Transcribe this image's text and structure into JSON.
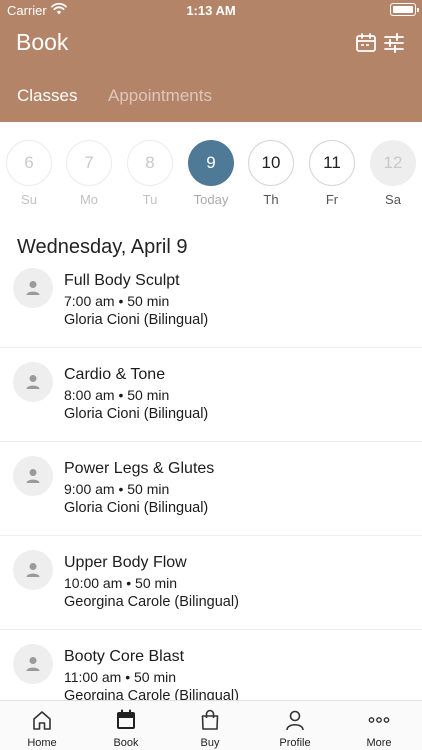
{
  "status": {
    "carrier": "Carrier",
    "time": "1:13 AM"
  },
  "header": {
    "title": "Book",
    "tabs": [
      "Classes",
      "Appointments"
    ],
    "active_tab": "Classes"
  },
  "date_strip": [
    {
      "num": "6",
      "dow": "Su",
      "state": "past"
    },
    {
      "num": "7",
      "dow": "Mo",
      "state": "past"
    },
    {
      "num": "8",
      "dow": "Tu",
      "state": "past"
    },
    {
      "num": "9",
      "dow": "Today",
      "state": "today"
    },
    {
      "num": "10",
      "dow": "Th",
      "state": "future"
    },
    {
      "num": "11",
      "dow": "Fr",
      "state": "future"
    },
    {
      "num": "12",
      "dow": "Sa",
      "state": "disabled"
    }
  ],
  "date_heading": "Wednesday, April 9",
  "classes": [
    {
      "name": "Full Body Sculpt",
      "time": "7:00 am • 50 min",
      "instructor": "Gloria Cioni (Bilingual)"
    },
    {
      "name": "Cardio & Tone",
      "time": "8:00 am • 50 min",
      "instructor": "Gloria Cioni (Bilingual)"
    },
    {
      "name": "Power Legs & Glutes",
      "time": "9:00 am • 50 min",
      "instructor": "Gloria Cioni (Bilingual)"
    },
    {
      "name": "Upper Body Flow",
      "time": "10:00 am • 50 min",
      "instructor": "Georgina Carole (Bilingual)"
    },
    {
      "name": "Booty Core Blast",
      "time": "11:00 am • 50 min",
      "instructor": "Georgina Carole (Bilingual)"
    }
  ],
  "tabbar": [
    {
      "label": "Home",
      "icon": "home-icon"
    },
    {
      "label": "Book",
      "icon": "calendar-icon"
    },
    {
      "label": "Buy",
      "icon": "shopping-bag-icon"
    },
    {
      "label": "Profile",
      "icon": "person-icon"
    },
    {
      "label": "More",
      "icon": "more-icon"
    }
  ],
  "colors": {
    "header": "#b38468",
    "today": "#4e7a97"
  }
}
